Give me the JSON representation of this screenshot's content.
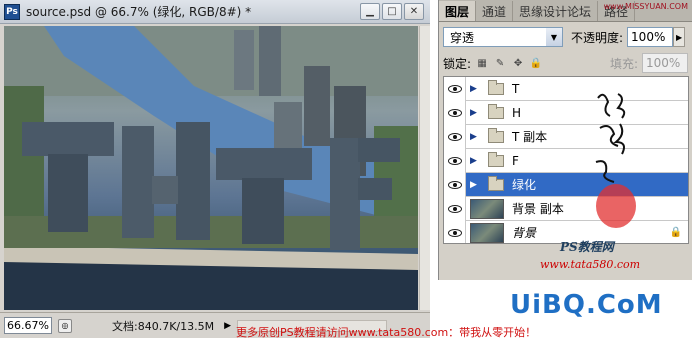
{
  "doc": {
    "title": "source.psd @ 66.7% (绿化, RGB/8#) *",
    "ps_icon": "Ps",
    "zoom": "66.67%",
    "info": "文档:840.7K/13.5M"
  },
  "panel": {
    "tabs": [
      "图层",
      "通道",
      "思缘设计论坛",
      "路径"
    ],
    "watermark": "www.MISSYUAN.COM",
    "blend_mode": "穿透",
    "opacity_label": "不透明度:",
    "opacity_value": "100%",
    "lock_label": "锁定:",
    "fill_label": "填充:",
    "fill_value": "100%",
    "layers": [
      {
        "name": "T",
        "type": "group",
        "selected": false
      },
      {
        "name": "H",
        "type": "group",
        "selected": false
      },
      {
        "name": "T 副本",
        "type": "group",
        "selected": false
      },
      {
        "name": "F",
        "type": "group",
        "selected": false
      },
      {
        "name": "绿化",
        "type": "group",
        "selected": true
      },
      {
        "name": "背景 副本",
        "type": "image",
        "selected": false
      },
      {
        "name": "背景",
        "type": "image",
        "selected": false,
        "locked": true
      }
    ]
  },
  "watermarks": {
    "site_cn": "PS教程网",
    "site_url": "www.tata580.com",
    "uibq": "UiBQ.CoM",
    "footer": "更多原创PS教程请访问www.tata580.com：带我从零开始！"
  },
  "colors": {
    "selection": "#316ac5",
    "panel_bg": "#d4d0c8",
    "watermark_red": "#d01010",
    "uibq_blue": "#1f6fc4"
  }
}
